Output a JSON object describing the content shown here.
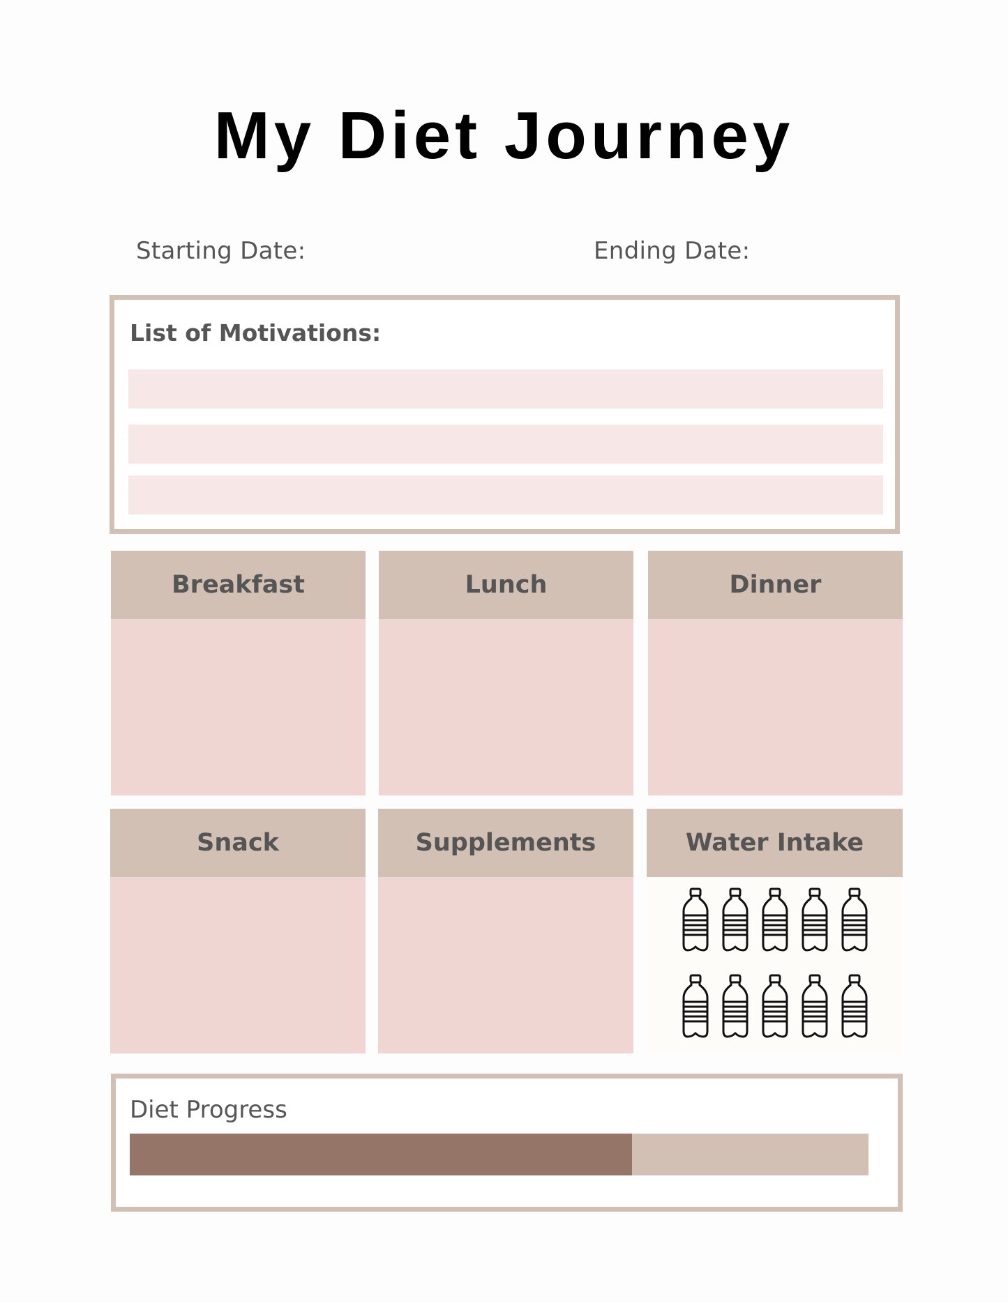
{
  "header": {
    "title": "My Diet Journey"
  },
  "dates": {
    "starting_label": "Starting Date:",
    "ending_label": "Ending Date:"
  },
  "motivations": {
    "title": "List of Motivations:",
    "lines": [
      "",
      "",
      ""
    ]
  },
  "meals": [
    {
      "label": "Breakfast"
    },
    {
      "label": "Lunch"
    },
    {
      "label": "Dinner"
    },
    {
      "label": "Snack"
    },
    {
      "label": "Supplements"
    },
    {
      "label": "Water Intake"
    }
  ],
  "water_intake": {
    "icon": "water-bottle-icon",
    "bottle_count": 10,
    "rows": 2,
    "columns": 5
  },
  "progress": {
    "title": "Diet Progress",
    "percent": 68
  },
  "colors": {
    "frame": "#d3c0b5",
    "header_fill": "#d3c0b5",
    "card_fill": "#f0d6d2",
    "line_fill": "#f7e7e6",
    "progress_fill": "#947568",
    "text": "#555555"
  }
}
